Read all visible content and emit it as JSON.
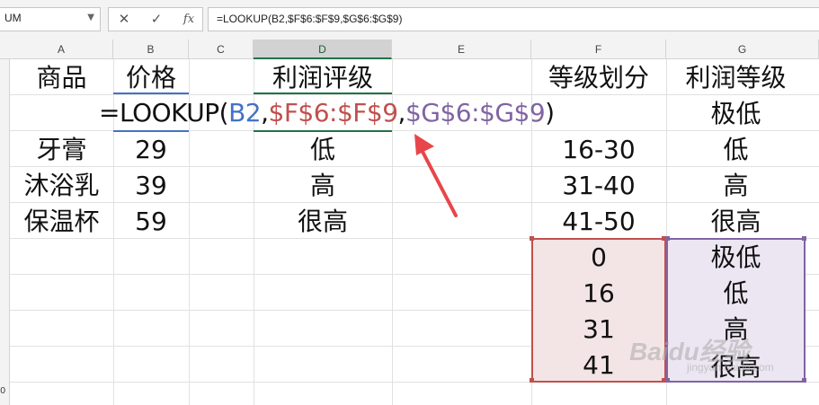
{
  "name_box": {
    "value": "UM"
  },
  "formula_bar": {
    "cancel_glyph": "✕",
    "enter_glyph": "✓",
    "fx_label": "fx",
    "formula": "=LOOKUP(B2,$F$6:$F$9,$G$6:$G$9)"
  },
  "columns": [
    "A",
    "B",
    "C",
    "D",
    "E",
    "F",
    "G"
  ],
  "rows": [
    "0"
  ],
  "cells": {
    "A1": "商品",
    "B1": "价格",
    "D1": "利润评级",
    "F1": "等级划分",
    "G1": "利润等级",
    "G2": "极低",
    "A3": "牙膏",
    "B3": "29",
    "D3": "低",
    "F3": "16-30",
    "G3": "低",
    "A4": "沐浴乳",
    "B4": "39",
    "D4": "高",
    "F4": "31-40",
    "G4": "高",
    "A5": "保温杯",
    "B5": "59",
    "D5": "很高",
    "F5": "41-50",
    "G5": "很高",
    "F6": "0",
    "G6": "极低",
    "F7": "16",
    "G7": "低",
    "F8": "31",
    "G8": "高",
    "F9": "41",
    "G9": "很高"
  },
  "edit_formula": {
    "prefix": "=LOOKUP(",
    "ref1": "B2",
    "sep1": ",",
    "ref2": "$F$6:$F$9",
    "sep2": ",",
    "ref3": "$G$6:$G$9",
    "suffix": ")"
  },
  "colors": {
    "ref1": "#4472c4",
    "ref2": "#c0504d",
    "ref3": "#8064a2",
    "arrow": "#e8464a",
    "header_green": "#217346"
  },
  "watermark": {
    "main": "Baidu经验",
    "sub": "jingyan.baidu.com"
  }
}
